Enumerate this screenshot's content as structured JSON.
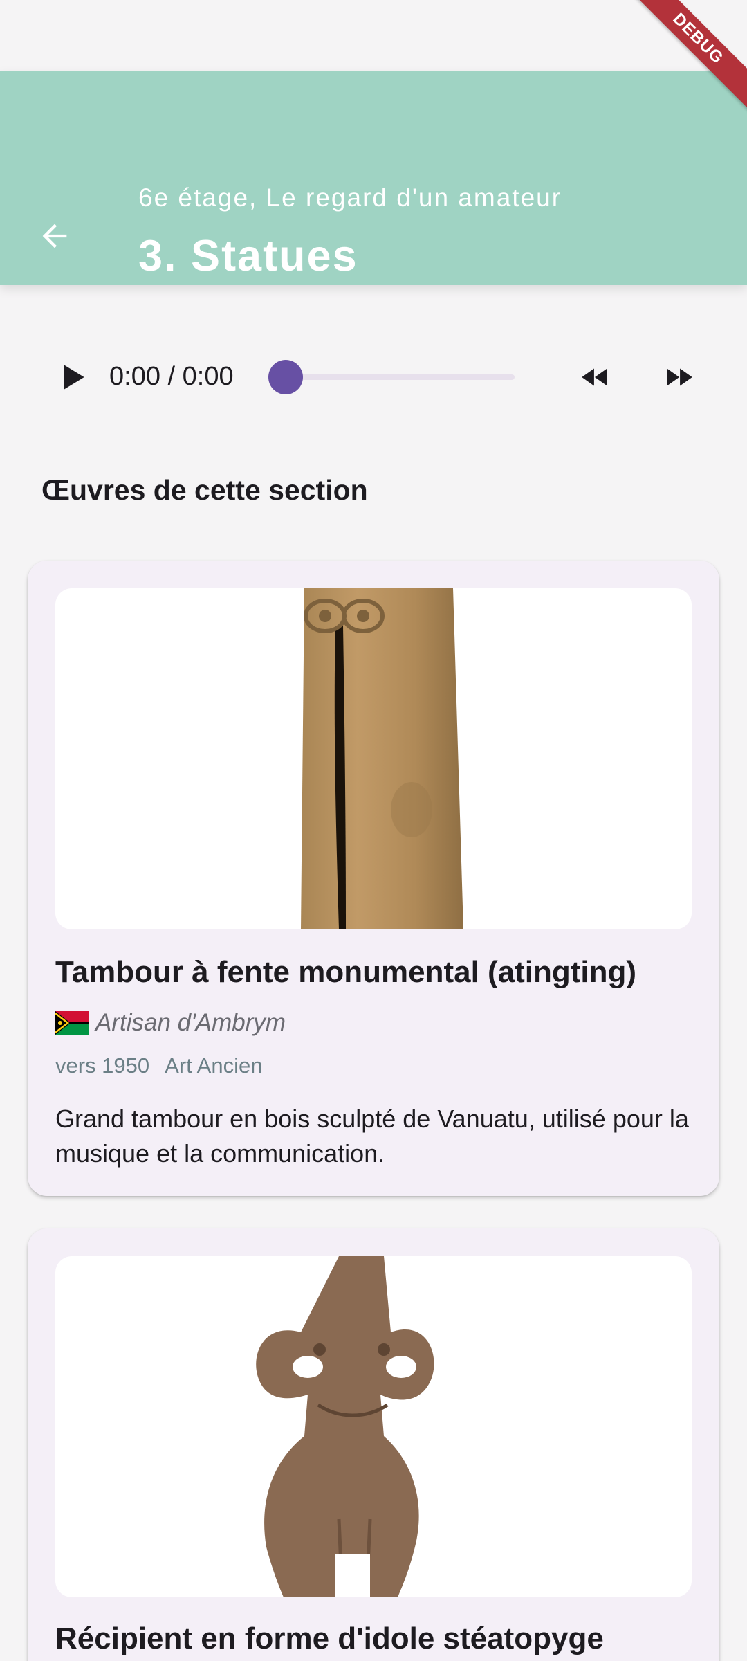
{
  "header": {
    "subtitle": "6e étage, Le regard d'un amateur",
    "title": "3. Statues",
    "back_icon": "arrow-back-icon"
  },
  "debug_banner": "DEBUG",
  "player": {
    "time": "0:00 / 0:00",
    "progress": 0,
    "play_icon": "play-icon",
    "rewind_icon": "rewind-icon",
    "forward_icon": "fast-forward-icon",
    "accent": "#6750a4"
  },
  "section": {
    "title": "Œuvres de cette section"
  },
  "works": [
    {
      "title": "Tambour à fente monumental (atingting)",
      "artist": "Artisan d'Ambrym",
      "flag": "vanuatu-flag-icon",
      "date": "vers 1950",
      "category": "Art Ancien",
      "description": "Grand tambour en bois sculpté de Vanuatu, utilisé pour la musique et la communication."
    },
    {
      "title": "Récipient en forme d'idole stéatopyge"
    }
  ],
  "colors": {
    "appbar": "#9fd3c3",
    "card": "#f4eff7",
    "background": "#f5f4f5"
  }
}
